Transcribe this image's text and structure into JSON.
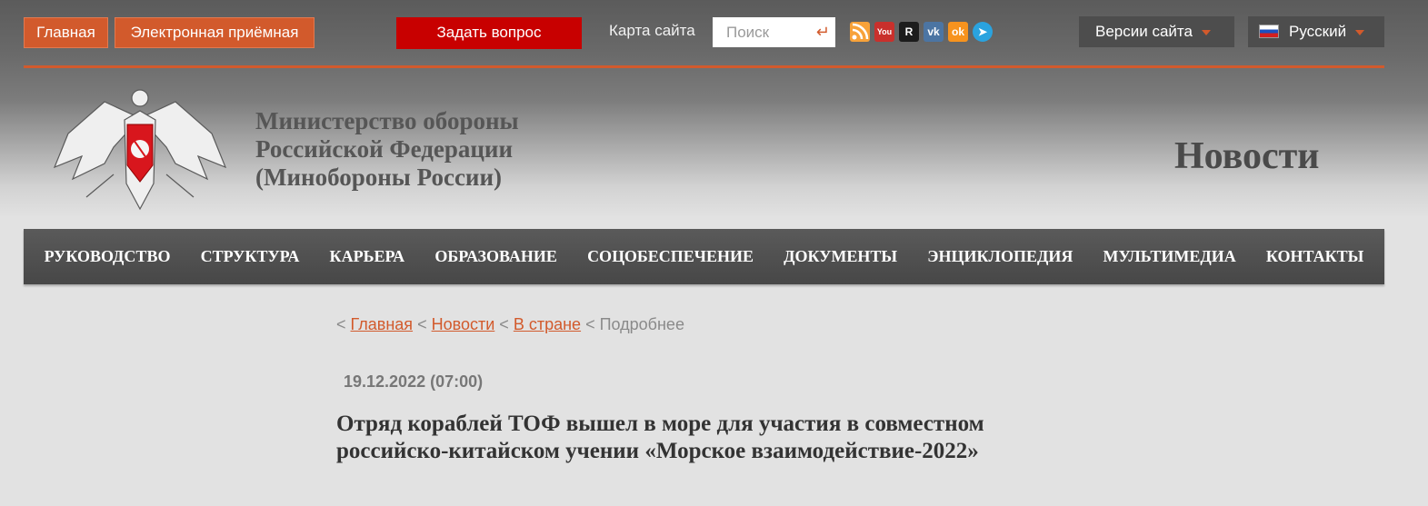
{
  "topbar": {
    "home": "Главная",
    "reception": "Электронная приёмная",
    "ask": "Задать вопрос",
    "sitemap": "Карта сайта",
    "search_placeholder": "Поиск",
    "versions": "Версии сайта",
    "language": "Русский"
  },
  "social": [
    {
      "name": "rss-icon",
      "glyph": "",
      "color": "#f7a23a"
    },
    {
      "name": "youtube-icon",
      "glyph": "You",
      "color": "#c9302c"
    },
    {
      "name": "rutube-icon",
      "glyph": "R",
      "color": "#1c1c1c"
    },
    {
      "name": "vk-icon",
      "glyph": "vk",
      "color": "#4c75a3"
    },
    {
      "name": "odnoklassniki-icon",
      "glyph": "ok",
      "color": "#f7931e"
    },
    {
      "name": "telegram-icon",
      "glyph": "➤",
      "color": "#2aa3df"
    }
  ],
  "ministry": {
    "line1": "Министерство обороны",
    "line2": "Российской Федерации",
    "line3": "(Минобороны России)"
  },
  "section_title": "Новости",
  "nav": [
    "РУКОВОДСТВО",
    "СТРУКТУРА",
    "КАРЬЕРА",
    "ОБРАЗОВАНИЕ",
    "СОЦОБЕСПЕЧЕНИЕ",
    "ДОКУМЕНТЫ",
    "ЭНЦИКЛОПЕДИЯ",
    "МУЛЬТИМЕДИА",
    "КОНТАКТЫ"
  ],
  "breadcrumb": {
    "home": "Главная",
    "news": "Новости",
    "country": "В стране",
    "current": "Подробнее",
    "sep": "<"
  },
  "article": {
    "date": "19.12.2022 (07:00)",
    "title": "Отряд кораблей ТОФ вышел в море для участия в совместном российско-китайском учении «Морское взаимодействие-2022»"
  }
}
